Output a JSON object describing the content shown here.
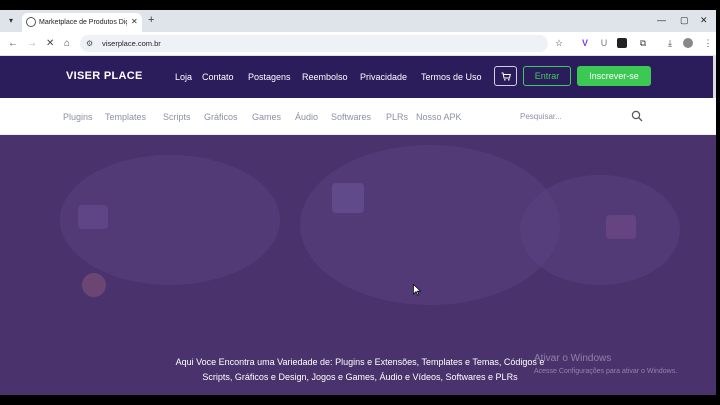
{
  "browser": {
    "tab_title": "Marketplace de Produtos Digi",
    "tab_close": "✕",
    "new_tab": "+",
    "url": "viserplace.com.br",
    "window_controls": [
      "—",
      "▢",
      "✕"
    ]
  },
  "site": {
    "logo": "VISER PLACE",
    "nav": [
      "Loja",
      "Contato",
      "Postagens",
      "Reembolso",
      "Privacidade",
      "Termos de Uso"
    ],
    "cart_icon": "cart-icon",
    "login_label": "Entrar",
    "signup_label": "Inscrever-se",
    "categories": [
      "Plugins",
      "Templates",
      "Scripts",
      "Gráficos",
      "Games",
      "Áudio",
      "Softwares",
      "PLRs",
      "Nosso APK"
    ],
    "search": {
      "placeholder": "Pesquisar..."
    }
  },
  "hero": {
    "line1": "Aqui Voce Encontra uma Variedade de: Plugins e Extensões, Templates e Temas, Códigos e",
    "line2": "Scripts, Gráficos e Design, Jogos e Games, Áudio e Vídeos, Softwares e PLRs"
  },
  "watermark": {
    "title": "Ativar o Windows",
    "subtitle": "Acesse Configurações para ativar o Windows."
  },
  "colors": {
    "header_bg": "#2b1d5c",
    "hero_bg": "#4a336c",
    "accent_green": "#3bc853",
    "category_text": "#8d90a6"
  }
}
